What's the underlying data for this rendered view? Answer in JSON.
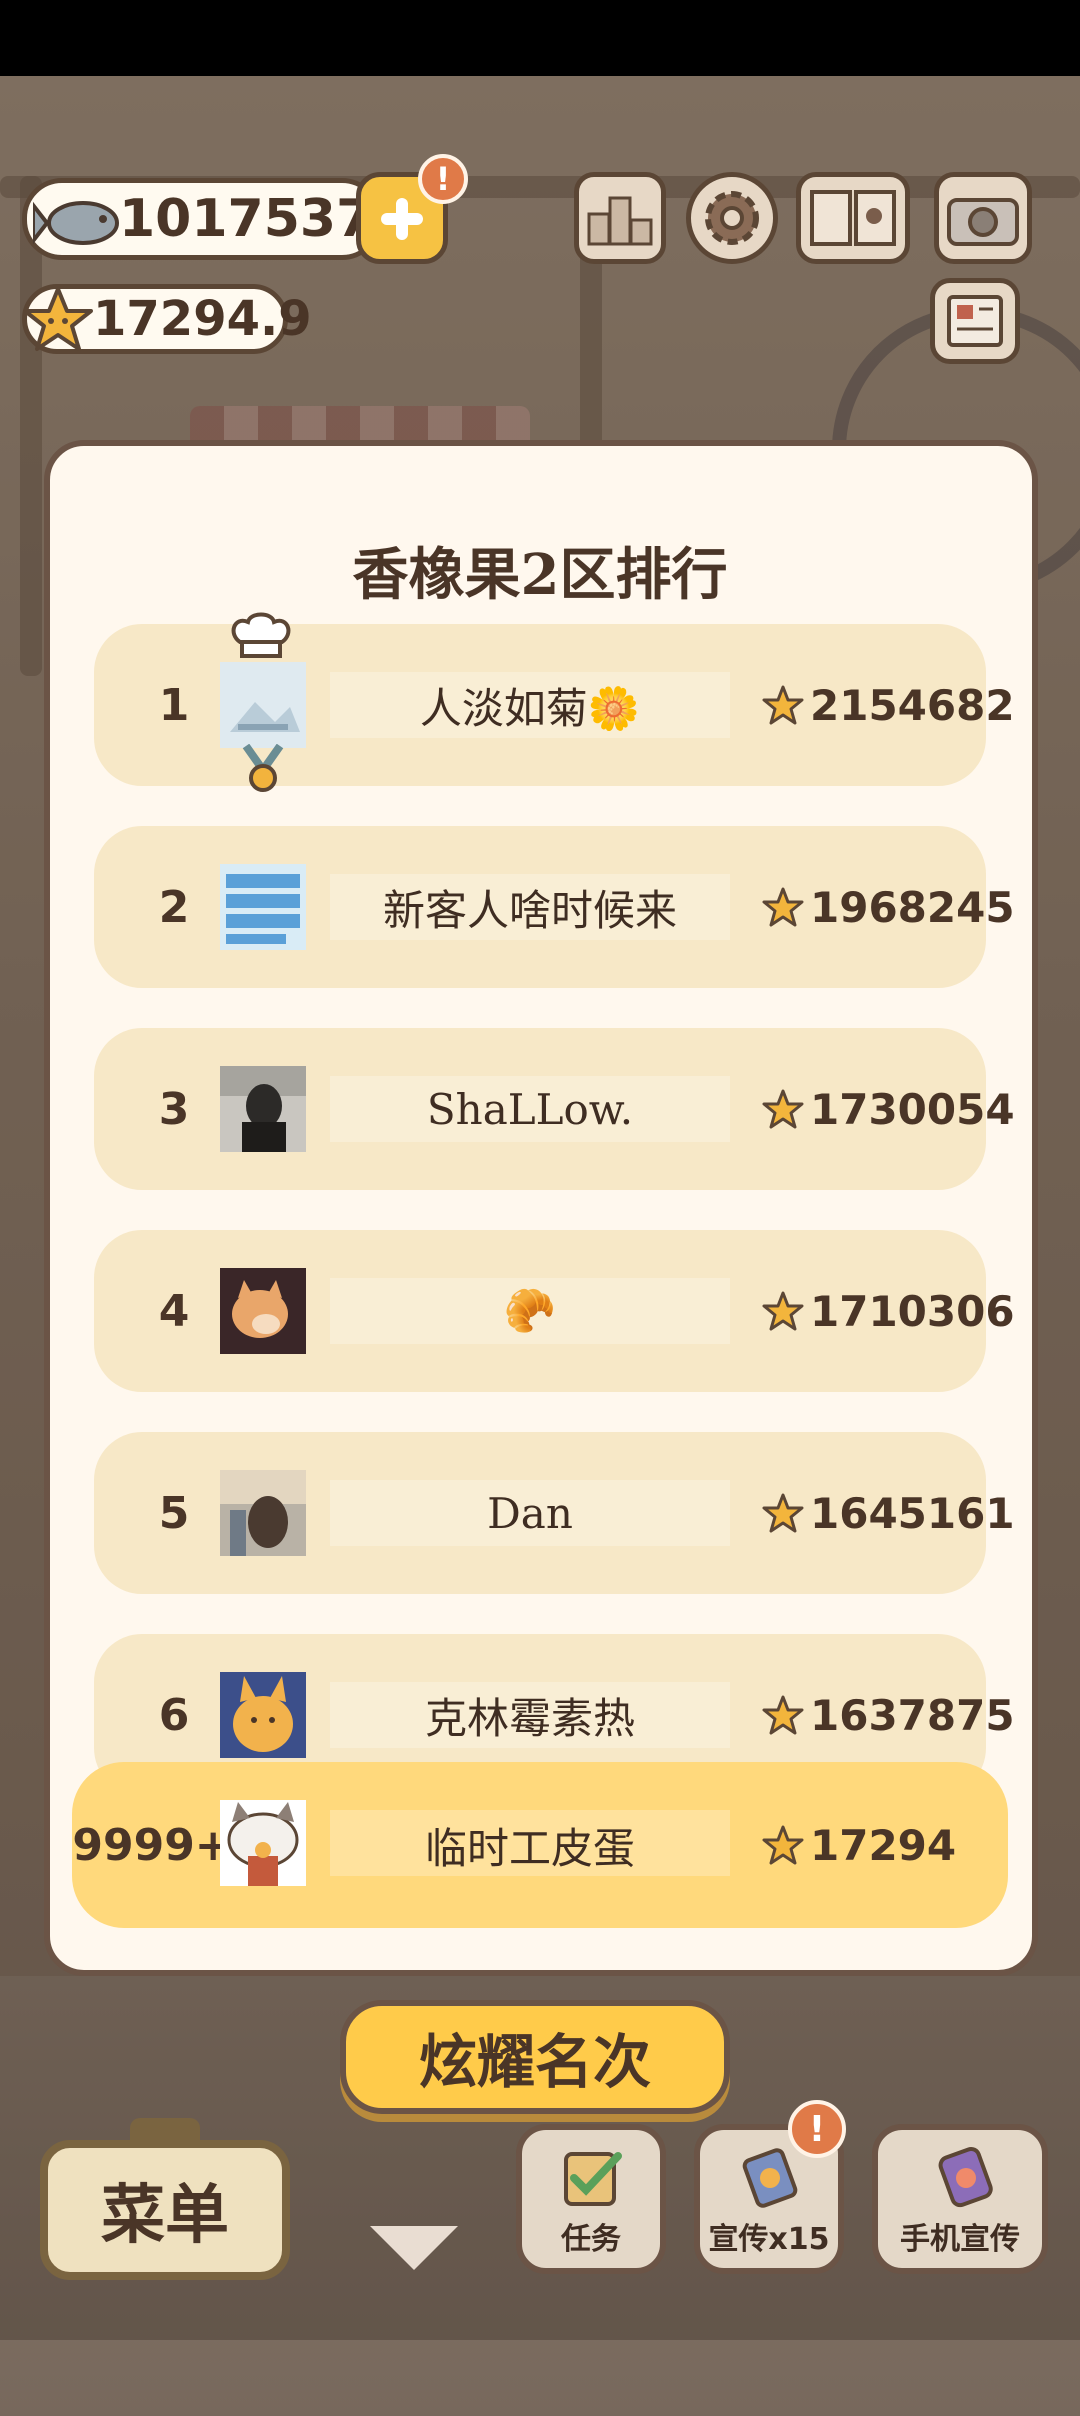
{
  "hud": {
    "fish_count": "1017537",
    "star_count": "17294.9",
    "plus_alert": "!",
    "promo_alert": "!"
  },
  "ranking": {
    "title": "香橡果2区排行",
    "rows": [
      {
        "rank": "1",
        "name": "人淡如菊🌼",
        "score": "2154682"
      },
      {
        "rank": "2",
        "name": "新客人啥时候来",
        "score": "1968245"
      },
      {
        "rank": "3",
        "name": "ShaLLow.",
        "score": "1730054"
      },
      {
        "rank": "4",
        "name": "🥐",
        "score": "1710306"
      },
      {
        "rank": "5",
        "name": "Dan",
        "score": "1645161"
      },
      {
        "rank": "6",
        "name": "克林霉素热",
        "score": "1637875"
      }
    ],
    "me": {
      "rank": "9999+",
      "name": "临时工皮蛋",
      "score": "17294"
    }
  },
  "buttons": {
    "show_rank": "炫耀名次",
    "menu": "菜单",
    "tasks": "任务",
    "promote": "宣传x15",
    "phone_promote": "手机宣传"
  },
  "colors": {
    "row_bg": "#f7e8c7",
    "my_row_bg": "#ffd97c",
    "accent_yellow": "#ffcb4a",
    "text_brown": "#4a3527"
  }
}
